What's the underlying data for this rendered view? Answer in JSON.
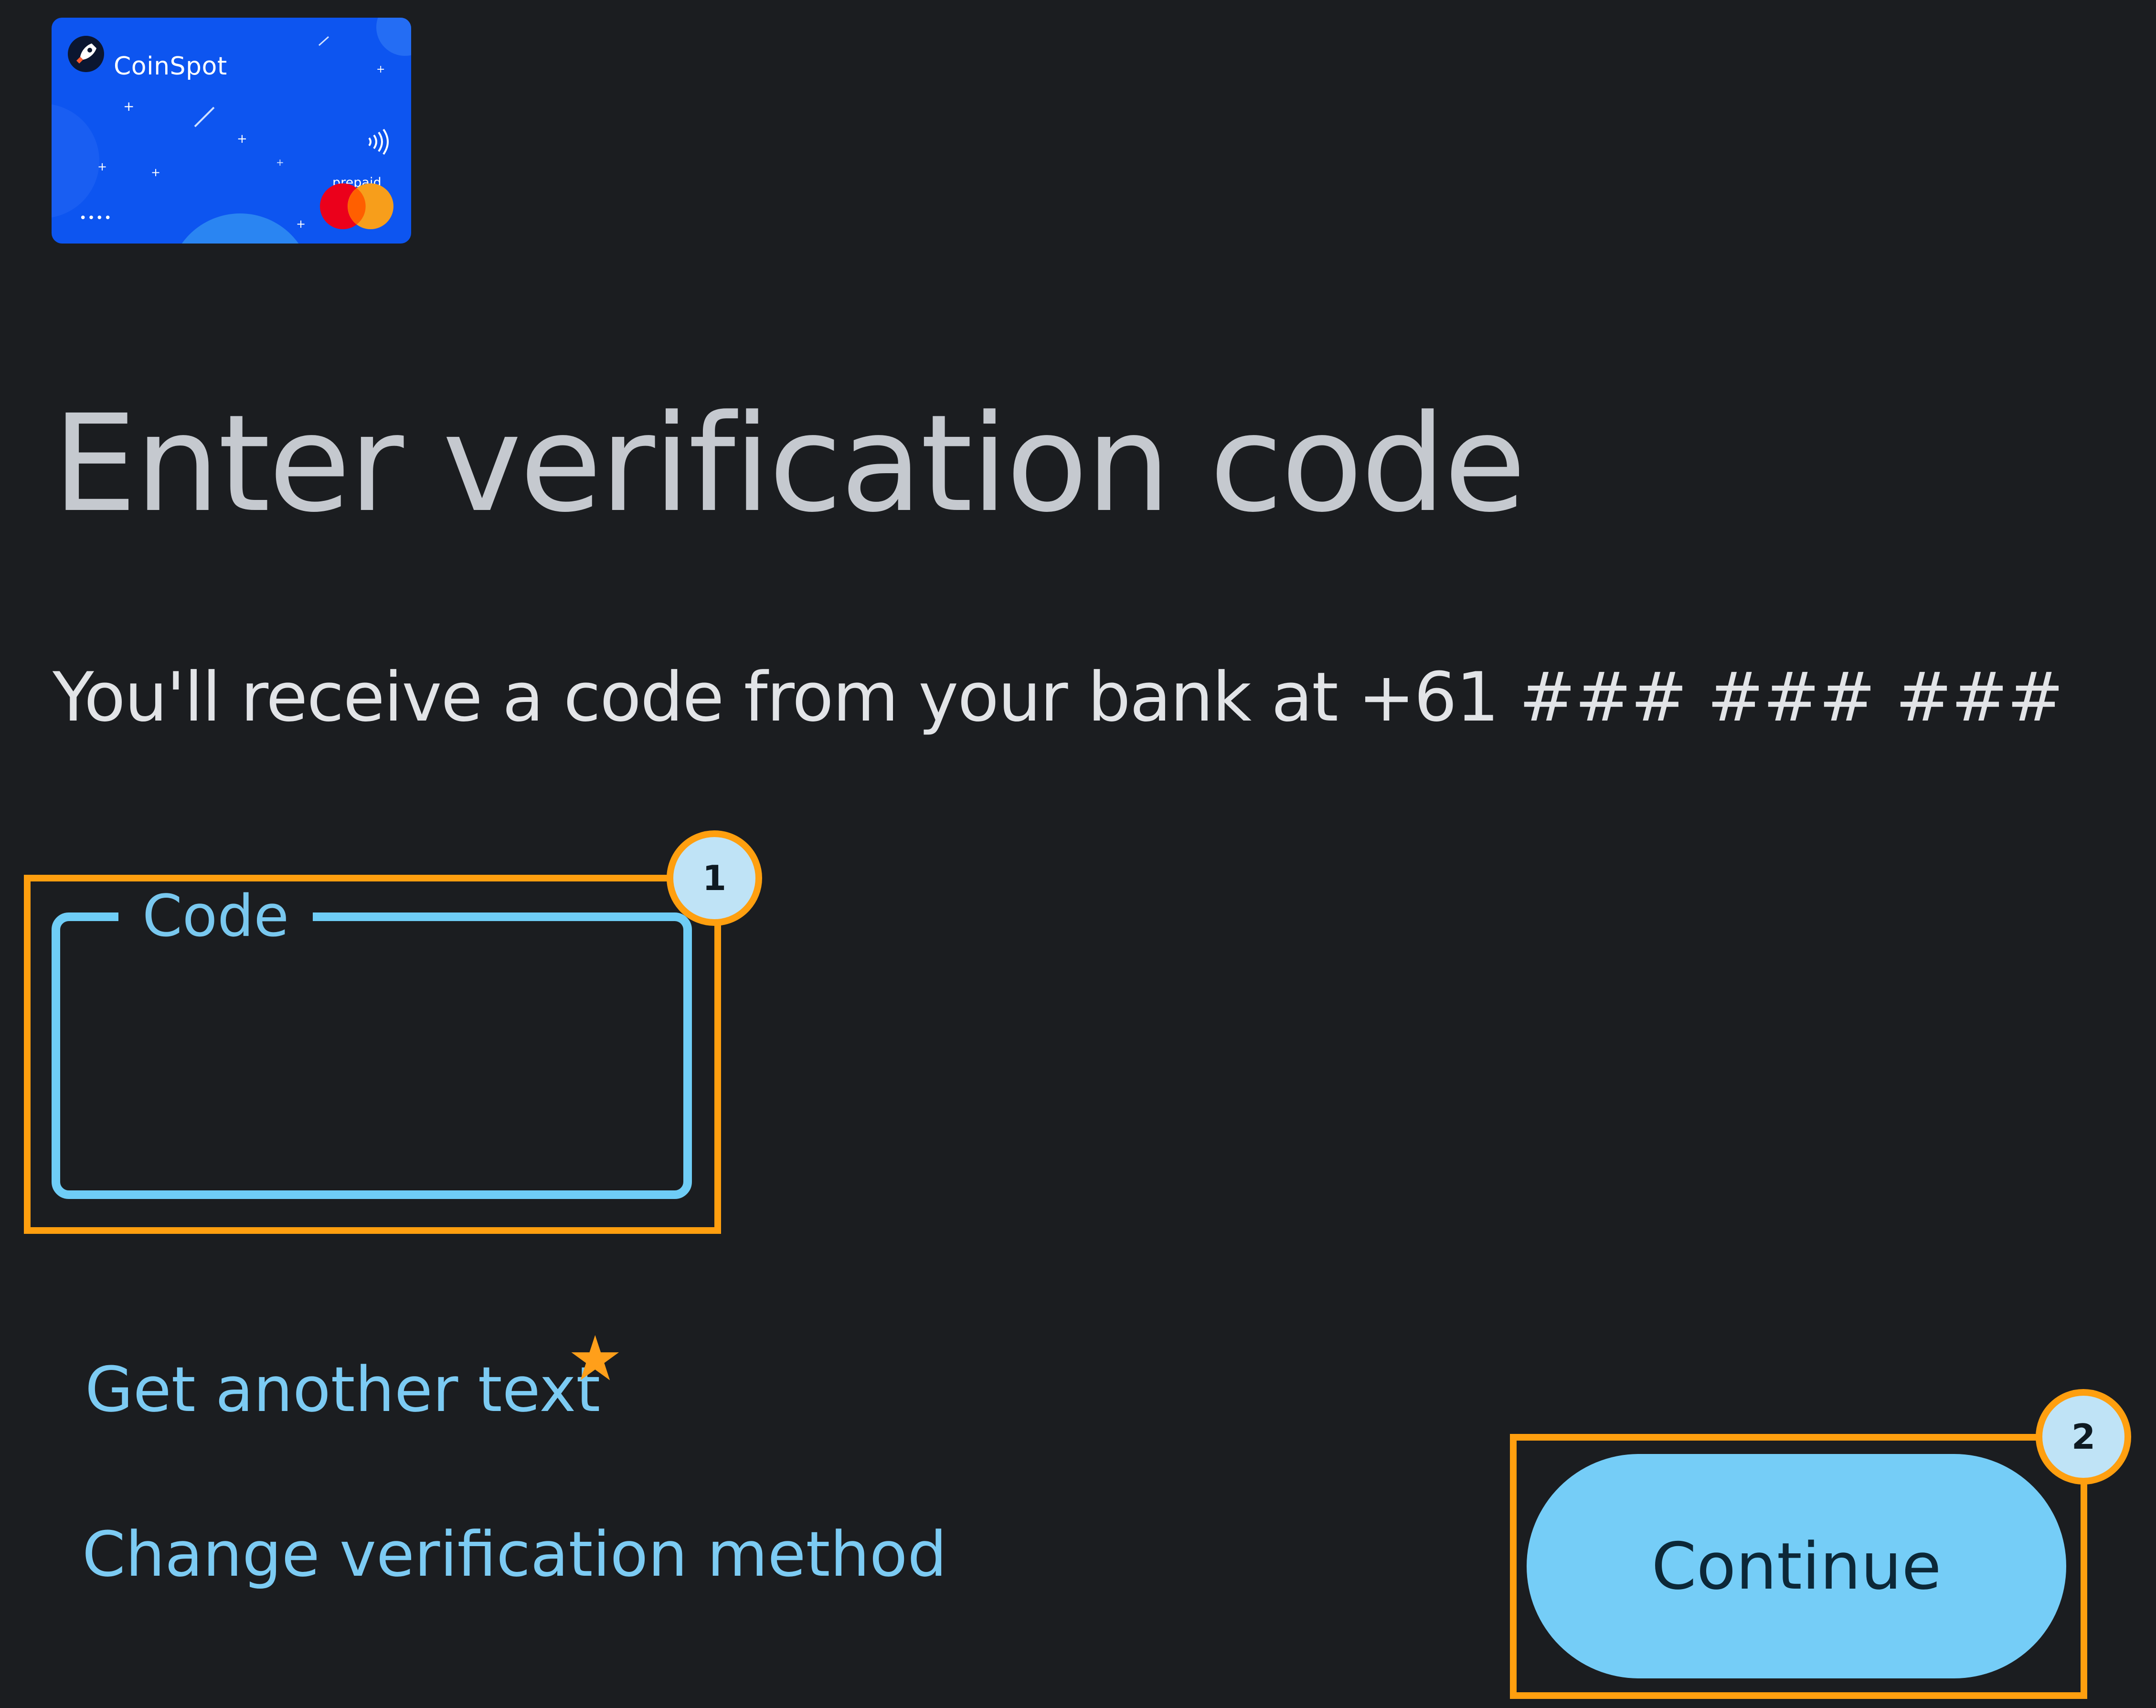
{
  "card": {
    "brand": "CoinSpot",
    "prepaid_label": "prepaid",
    "masked_number": "••••",
    "network": "mastercard",
    "card_color": "#0d55f0"
  },
  "page": {
    "title": "Enter verification code",
    "subtitle": "You'll receive a code from your bank at +61 ### ### ###"
  },
  "form": {
    "code_label": "Code",
    "code_value": ""
  },
  "links": {
    "resend": "Get another text",
    "change_method": "Change verification method"
  },
  "actions": {
    "continue_label": "Continue"
  },
  "annotations": {
    "badge_1": "1",
    "badge_2": "2",
    "accent_color": "#ff9f0f",
    "star_icon": "star-icon"
  },
  "theme": {
    "background": "#1b1d20",
    "accent": "#75cdf7",
    "link_color": "#7ccbf3"
  }
}
